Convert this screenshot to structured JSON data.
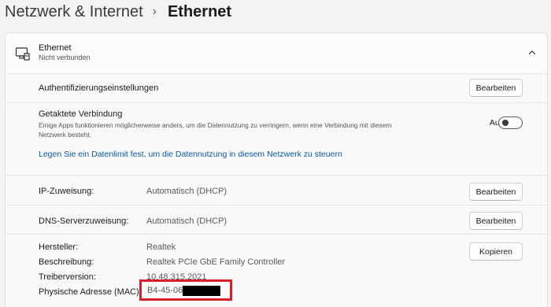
{
  "breadcrumb": {
    "parent": "Netzwerk & Internet",
    "separator": "›",
    "current": "Ethernet"
  },
  "header": {
    "title": "Ethernet",
    "status": "Nicht verbunden",
    "icon": "ethernet-icon",
    "expander_icon": "chevron-up-icon"
  },
  "auth": {
    "label": "Authentifizierungseinstellungen",
    "button": "Bearbeiten"
  },
  "metered": {
    "title": "Getaktete Verbindung",
    "description": "Einige Apps funktionieren möglicherweise anders, um die Datennutzung zu verringern, wenn eine Verbindung mit diesem Netzwerk besteht.",
    "toggle_label": "Aus",
    "link": "Legen Sie ein Datenlimit fest, um die Datennutzung in diesem Netzwerk zu steuern"
  },
  "ip": {
    "label": "IP-Zuweisung:",
    "value": "Automatisch (DHCP)",
    "button": "Bearbeiten"
  },
  "dns": {
    "label": "DNS-Serverzuweisung:",
    "value": "Automatisch (DHCP)",
    "button": "Bearbeiten"
  },
  "properties": {
    "manufacturer_label": "Hersteller:",
    "manufacturer": "Realtek",
    "description_label": "Beschreibung:",
    "description": "Realtek PCIe GbE Family Controller",
    "driver_label": "Treiberversion:",
    "driver": "10.48.315.2021",
    "mac_label": "Physische Adresse (MAC):",
    "mac": "B4-45-06-",
    "copy_button": "Kopieren"
  },
  "colors": {
    "accent_link": "#0a5aa8",
    "highlight_border": "#d6202c"
  }
}
